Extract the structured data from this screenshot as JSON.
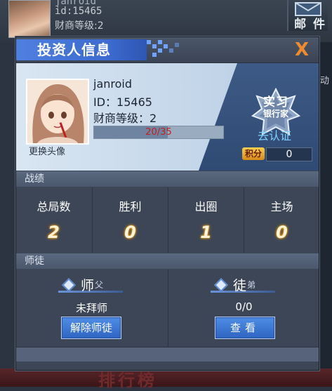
{
  "background": {
    "player_name": "janroid",
    "player_id": "id:15465",
    "player_level": "财商等级:2",
    "mail_label": "邮 件",
    "side_label": "动",
    "rank_label": "排行榜"
  },
  "dialog": {
    "title": "投资人信息",
    "close_label": "X"
  },
  "profile": {
    "name": "janroid",
    "id": "ID：15465",
    "level": "财商等级：2",
    "xp_text": "20/35",
    "xp_current": 20,
    "xp_max": 35,
    "change_avatar": "更换头像",
    "badge_line1": "实习",
    "badge_line2": "银行家",
    "verify": "去认证",
    "points_label": "积分",
    "points_value": "0"
  },
  "stats": {
    "header": "战绩",
    "items": [
      {
        "label": "总局数",
        "value": "2"
      },
      {
        "label": "胜利",
        "value": "0"
      },
      {
        "label": "出圈",
        "value": "1"
      },
      {
        "label": "主场",
        "value": "0"
      }
    ]
  },
  "mentor": {
    "header": "师徒",
    "master": {
      "title_big": "师",
      "title_small": "父",
      "value": "未拜师",
      "button": "解除师徒"
    },
    "disciple": {
      "title_big": "徒",
      "title_small": "弟",
      "value": "0/0",
      "button": "查看"
    }
  },
  "colors": {
    "accent": "#3d6bd0",
    "close": "#f08a2a",
    "xp_text": "#c41e1e",
    "verify": "#7fd0ff"
  }
}
